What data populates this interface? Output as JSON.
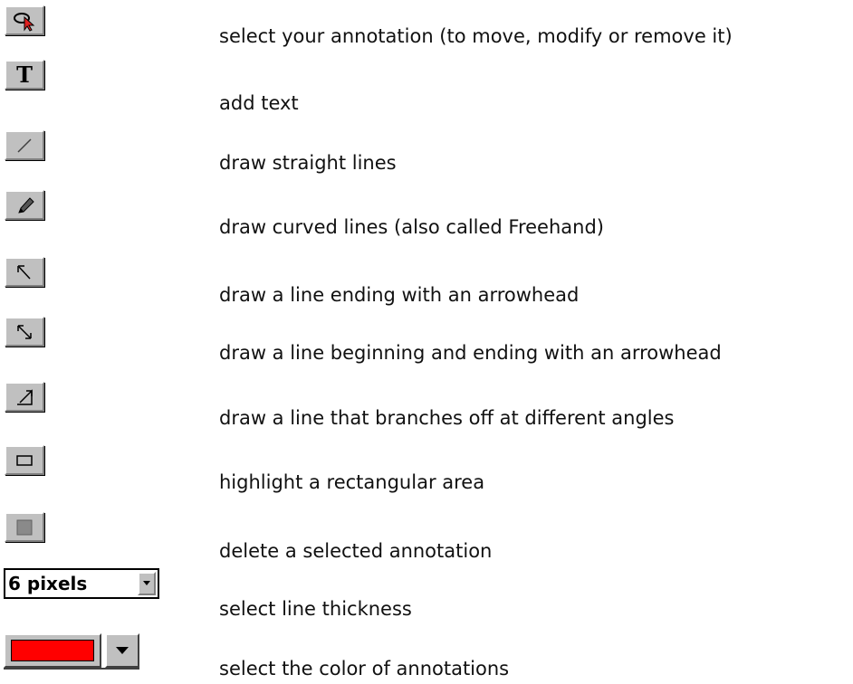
{
  "legend": {
    "items": [
      {
        "icon": "select-pointer-icon",
        "label": "select your annotation (to move, modify or remove it)"
      },
      {
        "icon": "text-tool-icon",
        "label": "add text",
        "glyph": "T"
      },
      {
        "icon": "straight-line-icon",
        "label": "draw straight lines"
      },
      {
        "icon": "pencil-icon",
        "label": "draw curved lines (also called Freehand)"
      },
      {
        "icon": "arrow-line-icon",
        "label": "draw a line ending with an arrowhead"
      },
      {
        "icon": "double-arrow-line-icon",
        "label": "draw a line beginning and ending with an arrowhead"
      },
      {
        "icon": "branch-line-icon",
        "label": "draw a line that branches off at different angles"
      },
      {
        "icon": "rectangle-icon",
        "label": "highlight a rectangular area"
      },
      {
        "icon": "delete-annotation-icon",
        "label": "delete a selected annotation"
      }
    ],
    "thickness": {
      "value": "6 pixels",
      "label": "select line thickness"
    },
    "color": {
      "value": "#ff0000",
      "label": "select the color of annotations"
    }
  }
}
